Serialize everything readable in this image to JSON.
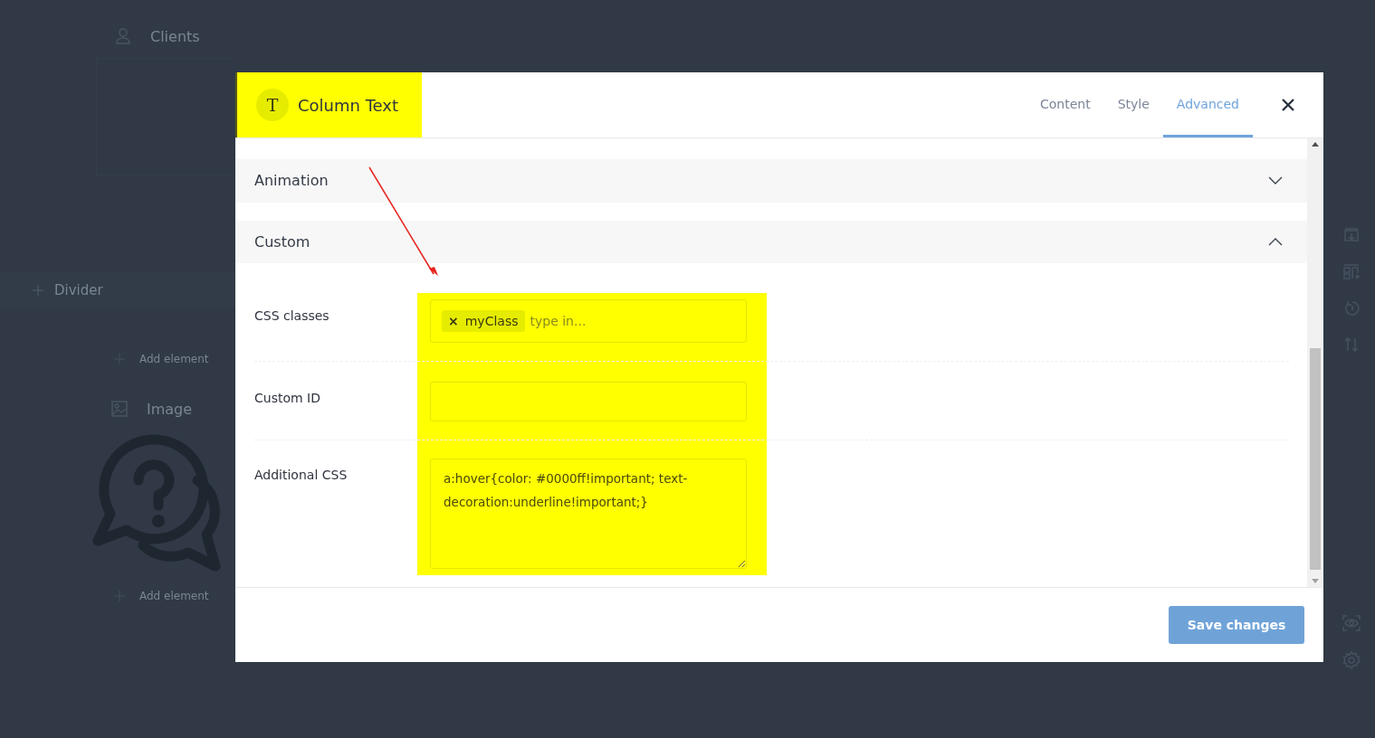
{
  "background": {
    "clients_label": "Clients",
    "divider_label": "Divider",
    "add_element_labels": [
      "Add element",
      "Add element"
    ],
    "image_label": "Image"
  },
  "modal": {
    "icon_letter": "T",
    "title": "Column Text",
    "tabs": [
      {
        "label": "Content",
        "selected": false
      },
      {
        "label": "Style",
        "selected": false
      },
      {
        "label": "Advanced",
        "selected": true
      }
    ],
    "sections": [
      {
        "label": "Animation",
        "expanded": false
      },
      {
        "label": "Custom",
        "expanded": true
      }
    ],
    "fields": [
      {
        "kind": "tags",
        "label": "CSS classes",
        "tags": [
          {
            "remove_symbol": "×",
            "text": "myClass"
          }
        ],
        "placeholder": "type in..."
      },
      {
        "kind": "text",
        "label": "Custom ID"
      },
      {
        "kind": "textarea",
        "label": "Additional CSS",
        "value": "a:hover{color: #0000ff!important; text-decoration:underline!important;}"
      }
    ],
    "save_button": "Save changes"
  }
}
